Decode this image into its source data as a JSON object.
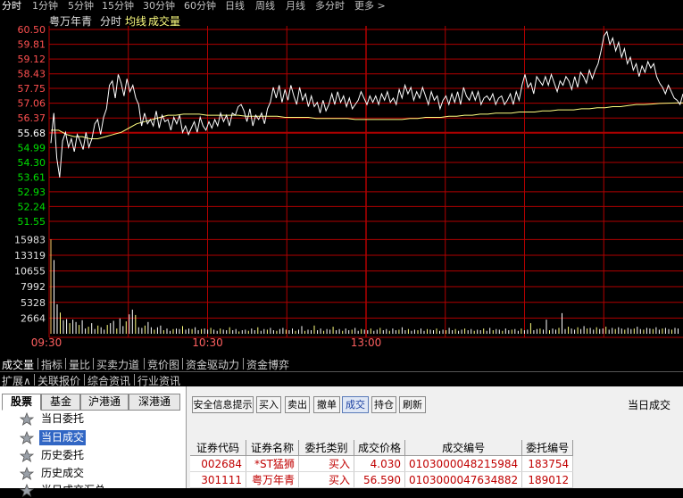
{
  "periods": [
    "分时",
    "1分钟",
    "5分钟",
    "15分钟",
    "30分钟",
    "60分钟",
    "日线",
    "周线",
    "月线",
    "多分时",
    "更多 >"
  ],
  "chart_header": {
    "stock": "粤万年青",
    "mode": "分时",
    "avg_label": "均线",
    "vol_label": "成交量"
  },
  "chart_data": [
    {
      "type": "line",
      "y_ticks": [
        "60.50",
        "59.81",
        "59.12",
        "58.43",
        "57.75",
        "57.06",
        "56.37",
        "55.68",
        "54.99",
        "54.30",
        "53.61",
        "52.93",
        "52.24",
        "51.55"
      ],
      "ylim": [
        51.55,
        60.5
      ],
      "reference_price": 55.68,
      "x_ticks": [
        "09:30",
        "10:30",
        "13:00"
      ],
      "series": [
        {
          "values": [
            55.2,
            56.6,
            54.5,
            53.6,
            55.3,
            55.7,
            55.0,
            55.4,
            54.8,
            55.6,
            55.3,
            54.9,
            55.7,
            55.0,
            55.4,
            56.1,
            56.3,
            55.6,
            56.4,
            56.8,
            57.9,
            58.1,
            57.3,
            58.4,
            58.0,
            57.4,
            58.2,
            57.6,
            57.9,
            57.3,
            57.0,
            56.0,
            56.6,
            56.1,
            56.3,
            56.0,
            56.7,
            55.9,
            56.5,
            56.2,
            56.3,
            55.8,
            56.4,
            56.1,
            56.5,
            55.7,
            56.0,
            55.6,
            55.9,
            56.2,
            55.7,
            56.4,
            56.0,
            55.8,
            56.2,
            55.9,
            56.3,
            56.0,
            56.6,
            56.2,
            56.5,
            56.0,
            56.6,
            56.5,
            56.9,
            57.0,
            56.7,
            56.2,
            56.8,
            56.0,
            56.5,
            56.3,
            56.6,
            56.1,
            56.8,
            57.1,
            57.8,
            57.3,
            57.9,
            57.1,
            57.7,
            57.2,
            57.9,
            57.4,
            57.0,
            57.8,
            57.2,
            57.5,
            56.9,
            57.4,
            56.9,
            57.1,
            56.6,
            57.2,
            56.7,
            57.0,
            57.5,
            57.0,
            57.6,
            57.1,
            57.4,
            56.9,
            57.3,
            56.8,
            57.0,
            57.2,
            57.6,
            57.3,
            57.0,
            57.4,
            57.1,
            57.4,
            57.0,
            57.5,
            57.2,
            57.6,
            57.1,
            57.3,
            57.0,
            57.7,
            57.3,
            57.9,
            57.5,
            57.8,
            57.2,
            57.6,
            57.3,
            57.8,
            57.4,
            57.0,
            57.6,
            57.2,
            57.4,
            56.8,
            57.2,
            57.4,
            57.0,
            57.5,
            57.1,
            57.6,
            57.0,
            57.8,
            57.4,
            57.2,
            57.6,
            57.2,
            57.6,
            57.0,
            57.3,
            57.4,
            57.2,
            57.5,
            57.0,
            57.3,
            57.4,
            57.0,
            57.2,
            57.5,
            57.0,
            57.6,
            57.2,
            57.9,
            58.4,
            57.8,
            58.0,
            57.5,
            58.3,
            58.1,
            57.9,
            58.3,
            57.9,
            58.4,
            58.0,
            57.6,
            58.1,
            57.9,
            58.3,
            58.1,
            57.7,
            58.3,
            57.8,
            58.5,
            58.3,
            58.0,
            58.6,
            58.2,
            58.6,
            58.9,
            59.5,
            60.2,
            60.4,
            59.8,
            60.1,
            59.5,
            59.9,
            59.2,
            59.6,
            58.9,
            59.2,
            58.6,
            58.9,
            58.3,
            58.8,
            58.5,
            59.0,
            58.7,
            58.9,
            58.3,
            58.0,
            57.8,
            57.5,
            57.9,
            57.6,
            57.3,
            57.2,
            57.0,
            57.5
          ]
        },
        {
          "values": [
            55.8,
            55.8,
            55.6,
            55.5,
            55.5,
            55.4,
            55.4,
            55.5,
            55.6,
            55.7,
            55.9,
            56.1,
            56.2,
            56.3,
            56.4,
            56.5,
            56.5,
            56.55,
            56.55,
            56.55,
            56.5,
            56.5,
            56.5,
            56.5,
            56.5,
            56.45,
            56.45,
            56.45,
            56.45,
            56.45,
            56.4,
            56.4,
            56.4,
            56.4,
            56.35,
            56.35,
            56.35,
            56.35,
            56.35,
            56.3,
            56.3,
            56.3,
            56.3,
            56.3,
            56.3,
            56.3,
            56.35,
            56.35,
            56.4,
            56.4,
            56.4,
            56.45,
            56.45,
            56.5,
            56.5,
            56.55,
            56.55,
            56.6,
            56.6,
            56.6,
            56.65,
            56.65,
            56.65,
            56.7,
            56.7,
            56.75,
            56.75,
            56.75,
            56.8,
            56.8,
            56.85,
            56.85,
            56.9,
            56.9,
            56.95,
            57.0,
            57.0,
            57.02,
            57.05,
            57.06,
            57.07,
            57.08
          ]
        }
      ]
    },
    {
      "type": "bar",
      "y_ticks": [
        "15983",
        "13319",
        "10655",
        "7992",
        "5328",
        "2664"
      ],
      "ylim": [
        0,
        16500
      ],
      "values": [
        16000,
        12500,
        5000,
        3600,
        2300,
        2500,
        1800,
        2400,
        2000,
        1500,
        2300,
        900,
        1200,
        1800,
        800,
        1400,
        1100,
        700,
        1500,
        1800,
        2200,
        900,
        2600,
        1300,
        2100,
        3300,
        4100,
        3200,
        1100,
        1000,
        1400,
        2000,
        1100,
        700,
        1100,
        1400,
        600,
        900,
        500,
        800,
        900,
        800,
        1300,
        700,
        900,
        800,
        1100,
        600,
        800,
        900,
        700,
        1000,
        700,
        500,
        900,
        700,
        600,
        1100,
        600,
        800,
        400,
        600,
        700,
        500,
        900,
        600,
        1100,
        500,
        800,
        700,
        1000,
        600,
        500,
        800,
        1000,
        700,
        600,
        900,
        500,
        700,
        1300,
        500,
        700,
        600,
        1400,
        600,
        900,
        500,
        800,
        700,
        1200,
        600,
        800,
        500,
        900,
        600,
        700,
        1000,
        500,
        800,
        700,
        600,
        900,
        500,
        700,
        1000,
        600,
        800,
        500,
        900,
        600,
        700,
        1100,
        600,
        800,
        500,
        700,
        600,
        900,
        500,
        800,
        700,
        600,
        900,
        500,
        700,
        600,
        1000,
        600,
        800,
        500,
        700,
        900,
        600,
        800,
        500,
        700,
        600,
        900,
        500,
        1000,
        600,
        800,
        700,
        500,
        900,
        600,
        700,
        800,
        500,
        900,
        600,
        700,
        1800,
        600,
        800,
        900,
        700,
        2400,
        600,
        900,
        700,
        1000,
        3500,
        800,
        1200,
        900,
        700,
        1100,
        800,
        1300,
        900,
        1000,
        700,
        1100,
        800,
        900,
        1200,
        700,
        1000,
        800,
        1100,
        900,
        700,
        1000,
        800,
        900,
        1200,
        800,
        700,
        1000,
        900,
        800,
        1100,
        700,
        900,
        1000,
        800,
        700,
        1000,
        900
      ]
    }
  ],
  "tabs_row1": [
    "成交量",
    "指标",
    "量比",
    "买卖力道",
    "竞价图",
    "资金驱动力",
    "资金博弈"
  ],
  "tabs_row2": [
    "扩展∧",
    "关联报价",
    "综合资讯",
    "行业资讯"
  ],
  "left_tabs": [
    "股票",
    "基金",
    "沪港通",
    "深港通"
  ],
  "tree_items": [
    "当日委托",
    "当日成交",
    "历史委托",
    "历史成交",
    "当日成交汇总"
  ],
  "toolbar": [
    "安全信息提示",
    "买入",
    "卖出",
    "撤单",
    "成交",
    "持仓",
    "刷新"
  ],
  "right_title": "当日成交",
  "table": {
    "headers": [
      "证券代码",
      "证券名称",
      "委托类别",
      "成交价格",
      "成交编号",
      "委托编号"
    ],
    "rows": [
      [
        "002684",
        "*ST猛狮",
        "买入",
        "4.030",
        "0103000048215984",
        "183754"
      ],
      [
        "301111",
        "粤万年青",
        "买入",
        "56.590",
        "0103000047634882",
        "189012"
      ]
    ]
  },
  "colors": {
    "grid_red": "#b00000",
    "price_line": "#ffffff",
    "avg_line": "#ffff80",
    "volume": "#ffffff",
    "up_text": "#ff5050",
    "down_text": "#00e000",
    "time_label": "#ff6060",
    "selection": "#3166c4"
  }
}
